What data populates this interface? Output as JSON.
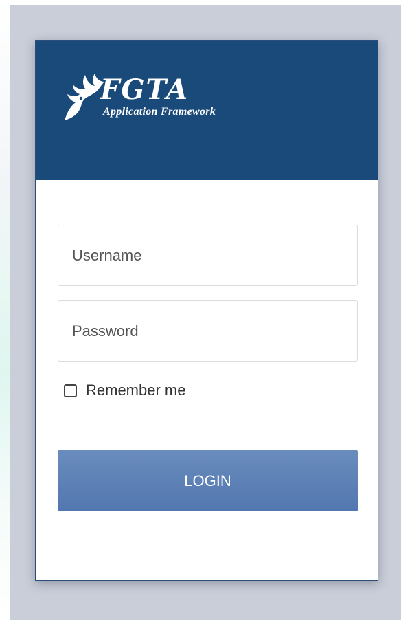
{
  "header": {
    "logo_title": "FGTA",
    "logo_subtitle": "Application Framework",
    "logo_icon": "dragon-logo-icon"
  },
  "form": {
    "username_placeholder": "Username",
    "username_value": "",
    "password_placeholder": "Password",
    "password_value": "",
    "remember_label": "Remember me",
    "remember_checked": false,
    "login_label": "LOGIN"
  },
  "colors": {
    "header_bg": "#1a4a7a",
    "button_bg": "#5b80b8",
    "page_bg": "#c9ced9"
  }
}
